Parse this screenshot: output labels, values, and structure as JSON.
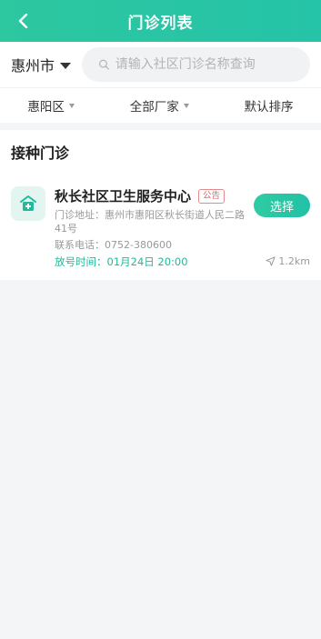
{
  "header": {
    "title": "门诊列表"
  },
  "search": {
    "city": "惠州市",
    "placeholder": "请输入社区门诊名称查询"
  },
  "filters": [
    {
      "label": "惠阳区"
    },
    {
      "label": "全部厂家"
    },
    {
      "label": "默认排序"
    }
  ],
  "section": {
    "title": "接种门诊"
  },
  "clinics": [
    {
      "name": "秋长社区卫生服务中心",
      "badge": "公告",
      "address": "门诊地址：惠州市惠阳区秋长街道人民二路41号",
      "phone": "联系电话：0752-380600",
      "release_time": "放号时间：01月24日 20:00",
      "select_label": "选择",
      "distance": "1.2km"
    }
  ],
  "colors": {
    "accent": "#2dc7a0",
    "badge": "#e06a6a"
  }
}
